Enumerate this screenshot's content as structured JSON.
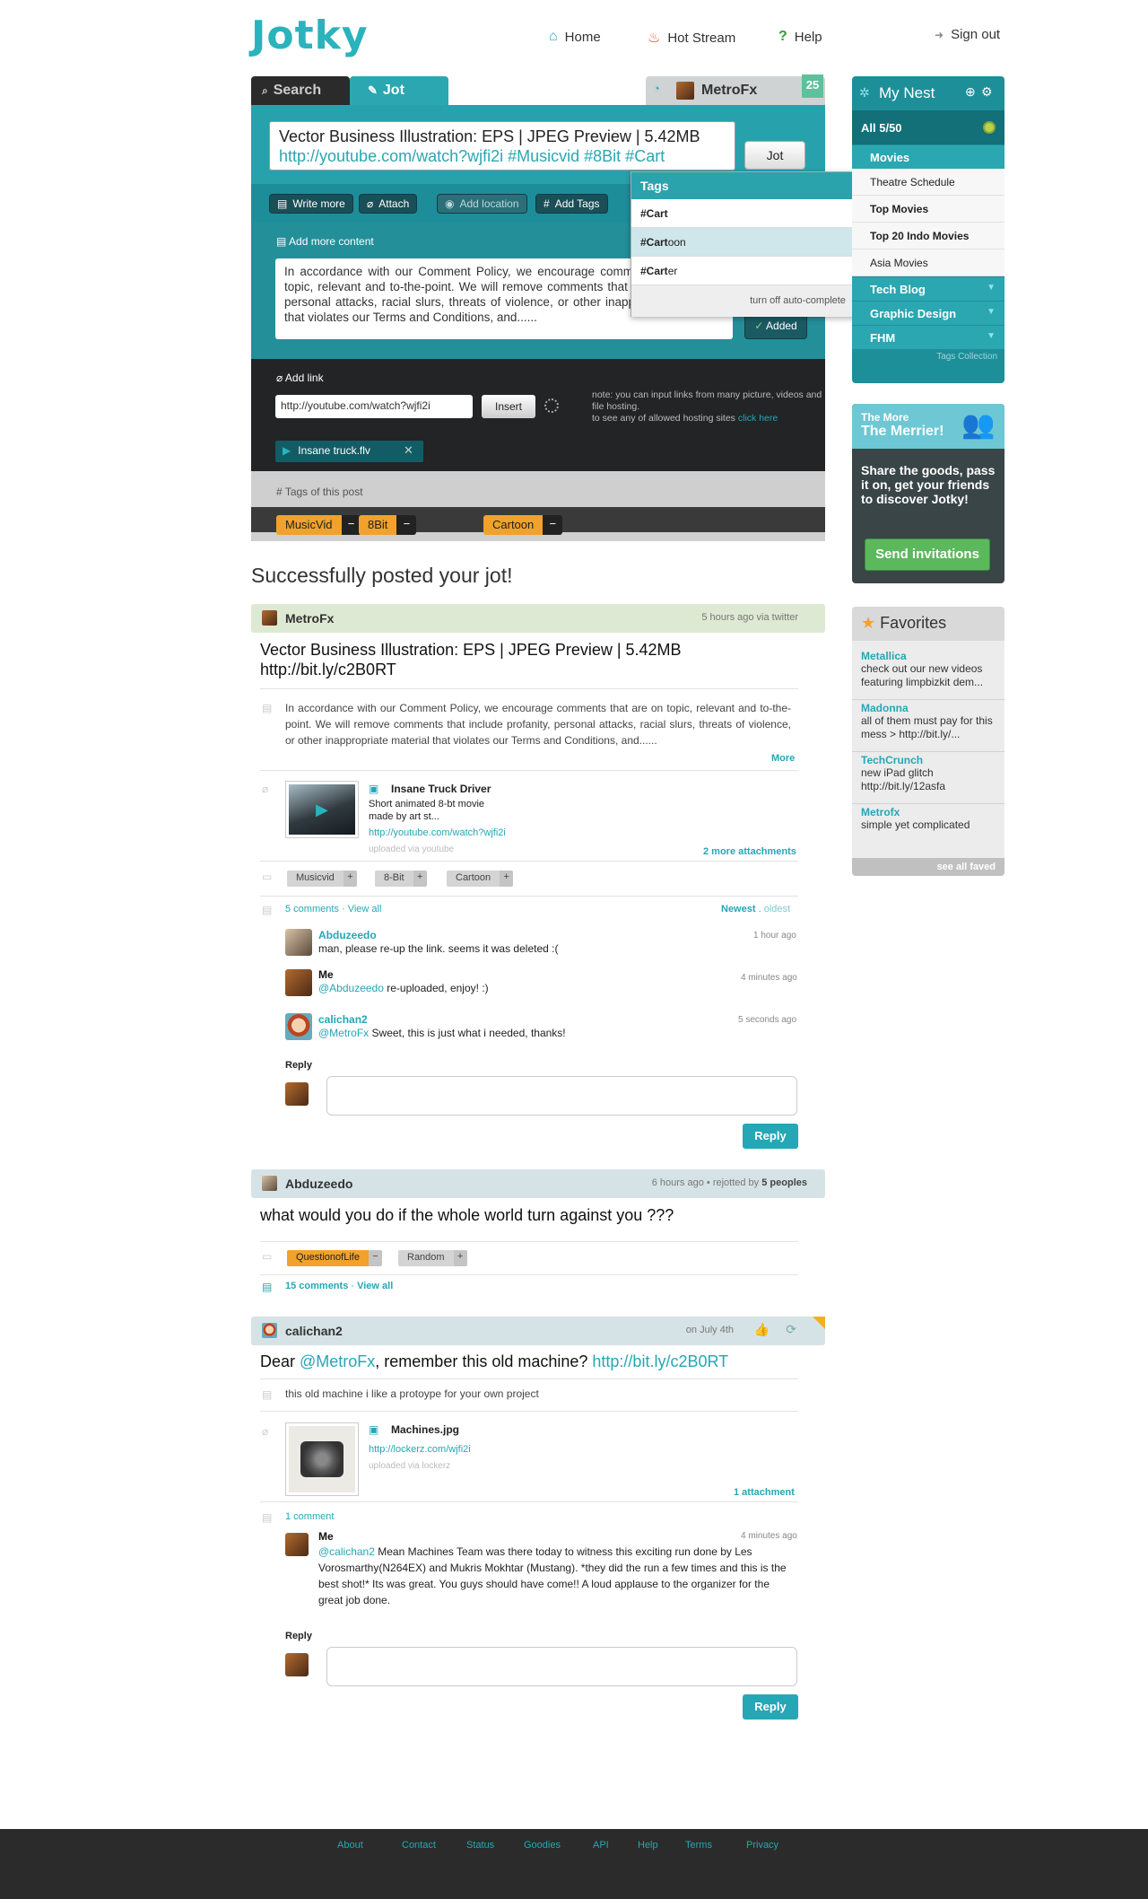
{
  "brand": {
    "logo_text": "Jotky",
    "accent": "#2aa7b1",
    "dark": "#222425",
    "orange": "#f0a22c"
  },
  "nav": {
    "home": "Home",
    "hot_stream": "Hot Stream",
    "help": "Help",
    "sign_out": "Sign out"
  },
  "jot": {
    "tab_search": "Search",
    "tab_jot": "Jot",
    "tab_user": "MetroFx",
    "user_badge": "25",
    "input_line1": "Vector Business Illustration: EPS | JPEG Preview | 5.42MB",
    "input_line2": "http://youtube.com/watch?wjfi2i #Musicvid  #8Bit  #Cart",
    "jot_button": "Jot",
    "tools": {
      "write_more": "Write more",
      "attach": "Attach",
      "add_location": "Add location",
      "add_tags": "Add Tags"
    },
    "add_more_label": "Add more content",
    "more_text": "In accordance with our Comment Policy, we encourage comments that are on topic, relevant and to-the-point. We will remove comments that include profanity, personal attacks, racial slurs, threats of violence, or other inappropriate material that violates our Terms and Conditions, and......",
    "added_button": "Added",
    "add_link_label": "Add link",
    "link_value": "http://youtube.com/watch?wjfi2i",
    "insert_button": "Insert",
    "link_note": "note: you can input links from many picture, videos and file hosting.",
    "link_note2": "to see any of allowed hosting sites",
    "link_note_link": "click here",
    "attached_file": "Insane truck.flv",
    "tags_label": "Tags of this post",
    "tags": [
      "MusicVid",
      "8Bit",
      "Cartoon"
    ]
  },
  "tags_dropdown": {
    "title": "Tags",
    "options": [
      {
        "match": "#Cart",
        "rest": ""
      },
      {
        "match": "#Cart",
        "rest": "oon"
      },
      {
        "match": "#Cart",
        "rest": "er"
      }
    ],
    "footer": "turn off auto-complete"
  },
  "success_message": "Successfully posted your jot!",
  "post1": {
    "user": "MetroFx",
    "meta": "5 hours ago   via twitter",
    "title": "Vector Business Illustration: EPS | JPEG Preview | 5.42MB",
    "short_link": "http://bit.ly/c2B0RT",
    "body": "In accordance with our Comment Policy, we encourage comments that are on topic, relevant and to-the-point. We will remove comments that include profanity, personal attacks, racial slurs, threats of violence, or other inappropriate material that violates our Terms and Conditions, and......",
    "more": "More",
    "attachment": {
      "title": "Insane Truck Driver",
      "desc1": "Short animated 8-bt movie",
      "desc2": "made by art st...",
      "url": "http://youtube.com/watch?wjfi2i",
      "source": "uploaded via youtube"
    },
    "more_attachments": "2 more attachments",
    "tags": [
      "Musicvid",
      "8-Bit",
      "Cartoon"
    ],
    "comments_count": "5 comments",
    "view_all": "View all",
    "sort_newest": "Newest",
    "sort_oldest": "oldest",
    "comments": [
      {
        "name": "Abduzeedo",
        "mention": "",
        "text": "man, please re-up the link. seems it was deleted :(",
        "time": "1 hour ago"
      },
      {
        "name": "Me",
        "mention": "@Abduzeedo",
        "text": " re-uploaded, enjoy! :)",
        "time": "4 minutes ago"
      },
      {
        "name": "calichan2",
        "mention": "@MetroFx",
        "text": " Sweet, this is just what i needed, thanks!",
        "time": "5 seconds ago"
      }
    ],
    "reply_label": "Reply",
    "reply_button": "Reply"
  },
  "post2": {
    "user": "Abduzeedo",
    "meta": "6 hours ago",
    "rejotted": "rejotted by",
    "rejotted_count": "5 peoples",
    "title": "what would you do if the whole world turn against you ???",
    "tags": [
      "QuestionofLife",
      "Random"
    ],
    "comments_count": "15 comments",
    "view_all": "View all"
  },
  "post3": {
    "user": "calichan2",
    "meta": "on July 4th",
    "title_pre": "Dear ",
    "title_mention": "@MetroFx",
    "title_mid": ", remember this old machine? ",
    "title_link": "http://bit.ly/c2B0RT",
    "body": "this old machine i like a protoype for your own project",
    "attachment": {
      "title": "Machines.jpg",
      "url": "http://lockerz.com/wjfi2i",
      "source": "uploaded via lockerz"
    },
    "attachments_count": "1 attachment",
    "comments_count": "1 comment",
    "comment": {
      "name": "Me",
      "time": "4 minutes ago",
      "mention": "@calichan2",
      "text": " Mean Machines Team was there today to witness this exciting run done by Les Vorosmarthy(N264EX) and Mukris Mokhtar (Mustang). *they did the run a few times and this is the best shot!* Its was great. You guys should have come!! A loud applause to the organizer for the great job done."
    },
    "reply_label": "Reply",
    "reply_button": "Reply"
  },
  "sidebar": {
    "nest_title": "My Nest",
    "all_label": "All  5/50",
    "categories": [
      "Movies",
      "Tech Blog",
      "Graphic Design",
      "FHM"
    ],
    "movie_items": [
      "Theatre Schedule",
      "Top Movies",
      "Top 20 Indo Movies",
      "Asia Movies"
    ],
    "tags_collection": "Tags Collection",
    "merrier_small": "The More",
    "merrier_big": "The Merrier!",
    "merrier_text": "Share the goods, pass it on, get your friends to discover Jotky!",
    "send_invitations": "Send invitations",
    "favorites_title": "Favorites",
    "favorites": [
      {
        "name": "Metallica",
        "text": "check out our new videos featuring limpbizkit dem..."
      },
      {
        "name": "Madonna",
        "text": "all of them must pay for this mess > http://bit.ly/..."
      },
      {
        "name": "TechCrunch",
        "text": "new iPad glitch http://bit.ly/12asfa"
      },
      {
        "name": "Metrofx",
        "text": "simple yet complicated"
      }
    ],
    "see_all_faved": "see all faved"
  },
  "footer": {
    "links": [
      "About",
      "Contact",
      "Status",
      "Goodies",
      "API",
      "Help",
      "Terms",
      "Privacy"
    ]
  }
}
